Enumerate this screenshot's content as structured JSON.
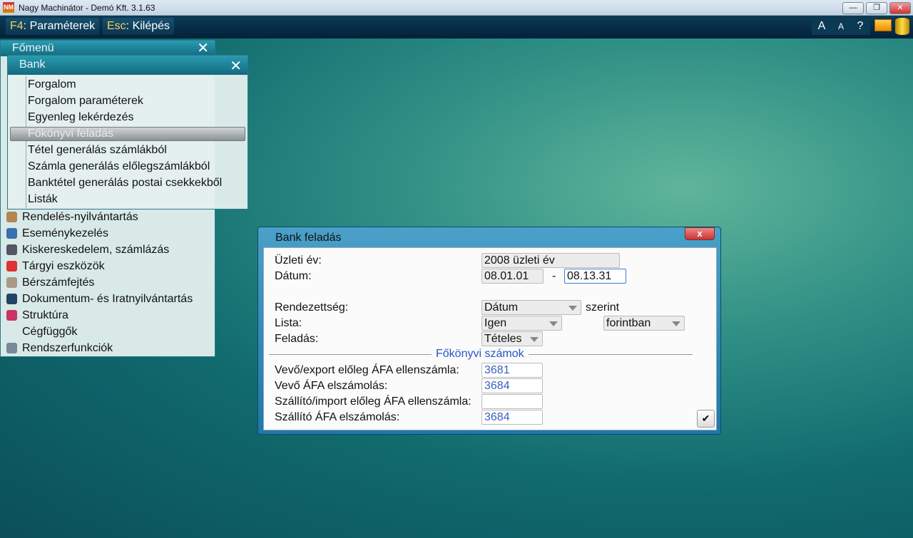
{
  "window": {
    "title": "Nagy Machinátor - Demó Kft. 3.1.63",
    "logo": "NM",
    "minimize": "—",
    "restore": "❐",
    "close": "✕"
  },
  "toolbar": {
    "f4_key": "F4",
    "f4_label": ": Paraméterek",
    "esc_key": "Esc",
    "esc_label": ": Kilépés",
    "font_large": "A",
    "font_small": "A",
    "help": "?"
  },
  "main_menu": {
    "title": "Főmenü",
    "close": "✕",
    "items": [
      {
        "label": "Rendelés-nyilvántartás",
        "icon": "package-icon",
        "color": "#b08850"
      },
      {
        "label": "Eseménykezelés",
        "icon": "person-icon",
        "color": "#3a6fb0"
      },
      {
        "label": "Kiskereskedelem, számlázás",
        "icon": "cash-register-icon",
        "color": "#556"
      },
      {
        "label": "Tárgyi eszközök",
        "icon": "house-icon",
        "color": "#d33"
      },
      {
        "label": "Bérszámfejtés",
        "icon": "payroll-icon",
        "color": "#a98"
      },
      {
        "label": "Dokumentum- és Iratnyilvántartás",
        "icon": "document-box-icon",
        "color": "#246"
      },
      {
        "label": "Struktúra",
        "icon": "cube-icon",
        "color": "#c36"
      },
      {
        "label": "Cégfüggők",
        "icon": "",
        "color": ""
      },
      {
        "label": "Rendszerfunkciók",
        "icon": "gears-icon",
        "color": "#789"
      }
    ]
  },
  "bank_menu": {
    "title": "Bank",
    "close": "✕",
    "selected_index": 3,
    "items": [
      "Forgalom",
      "Forgalom paraméterek",
      "Egyenleg lekérdezés",
      "Főkönyvi feladás",
      "Tétel generálás számlákból",
      "Számla generálás előlegszámlákból",
      "Banktétel generálás postai csekkekből",
      "Listák"
    ]
  },
  "dialog": {
    "title": "Bank feladás",
    "close": "x",
    "uzleti_ev_label": "Üzleti év:",
    "uzleti_ev": "2008 üzleti év",
    "datum_label": "Dátum:",
    "datum_from": "08.01.01",
    "datum_sep": "-",
    "datum_to": "08.13.31",
    "rendezettseg_label": "Rendezettség:",
    "rendezettseg": "Dátum",
    "szerint": "szerint",
    "lista_label": "Lista:",
    "lista": "Igen",
    "penznem": "forintban",
    "feladas_label": "Feladás:",
    "feladas": "Tételes",
    "section": "Főkönyvi számok",
    "accounts": [
      {
        "label": "Vevő/export előleg ÁFA ellenszámla:",
        "value": "3681"
      },
      {
        "label": "Vevő ÁFA elszámolás:",
        "value": "3684"
      },
      {
        "label": "Szállító/import előleg ÁFA ellenszámla:",
        "value": ""
      },
      {
        "label": "Szállító ÁFA elszámolás:",
        "value": "3684"
      }
    ],
    "ok": "✔"
  }
}
